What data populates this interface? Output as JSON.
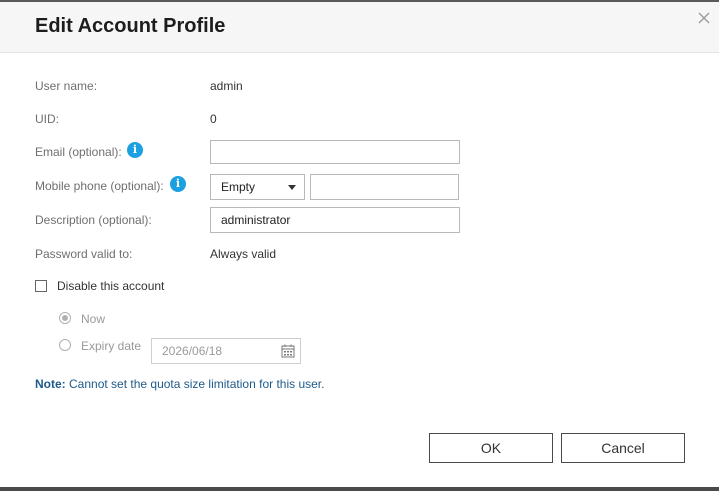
{
  "dialog": {
    "title": "Edit Account Profile",
    "close_icon": "close-icon"
  },
  "fields": {
    "username_label": "User name:",
    "username_value": "admin",
    "uid_label": "UID:",
    "uid_value": "0",
    "email_label": "Email (optional):",
    "email_value": "",
    "mobile_label": "Mobile phone (optional):",
    "mobile_country_selected": "Empty",
    "mobile_value": "",
    "description_label": "Description (optional):",
    "description_value": "administrator",
    "password_valid_label": "Password valid to:",
    "password_valid_value": "Always valid"
  },
  "disable_account": {
    "label": "Disable this account",
    "checked": false,
    "option_now": "Now",
    "option_expiry": "Expiry date",
    "expiry_date": "2026/06/18"
  },
  "note": {
    "prefix": "Note:",
    "text": " Cannot set the quota size limitation for this user."
  },
  "buttons": {
    "ok": "OK",
    "cancel": "Cancel"
  },
  "colors": {
    "info_icon": "#1ba1e2",
    "note_text": "#1e5a8a"
  }
}
